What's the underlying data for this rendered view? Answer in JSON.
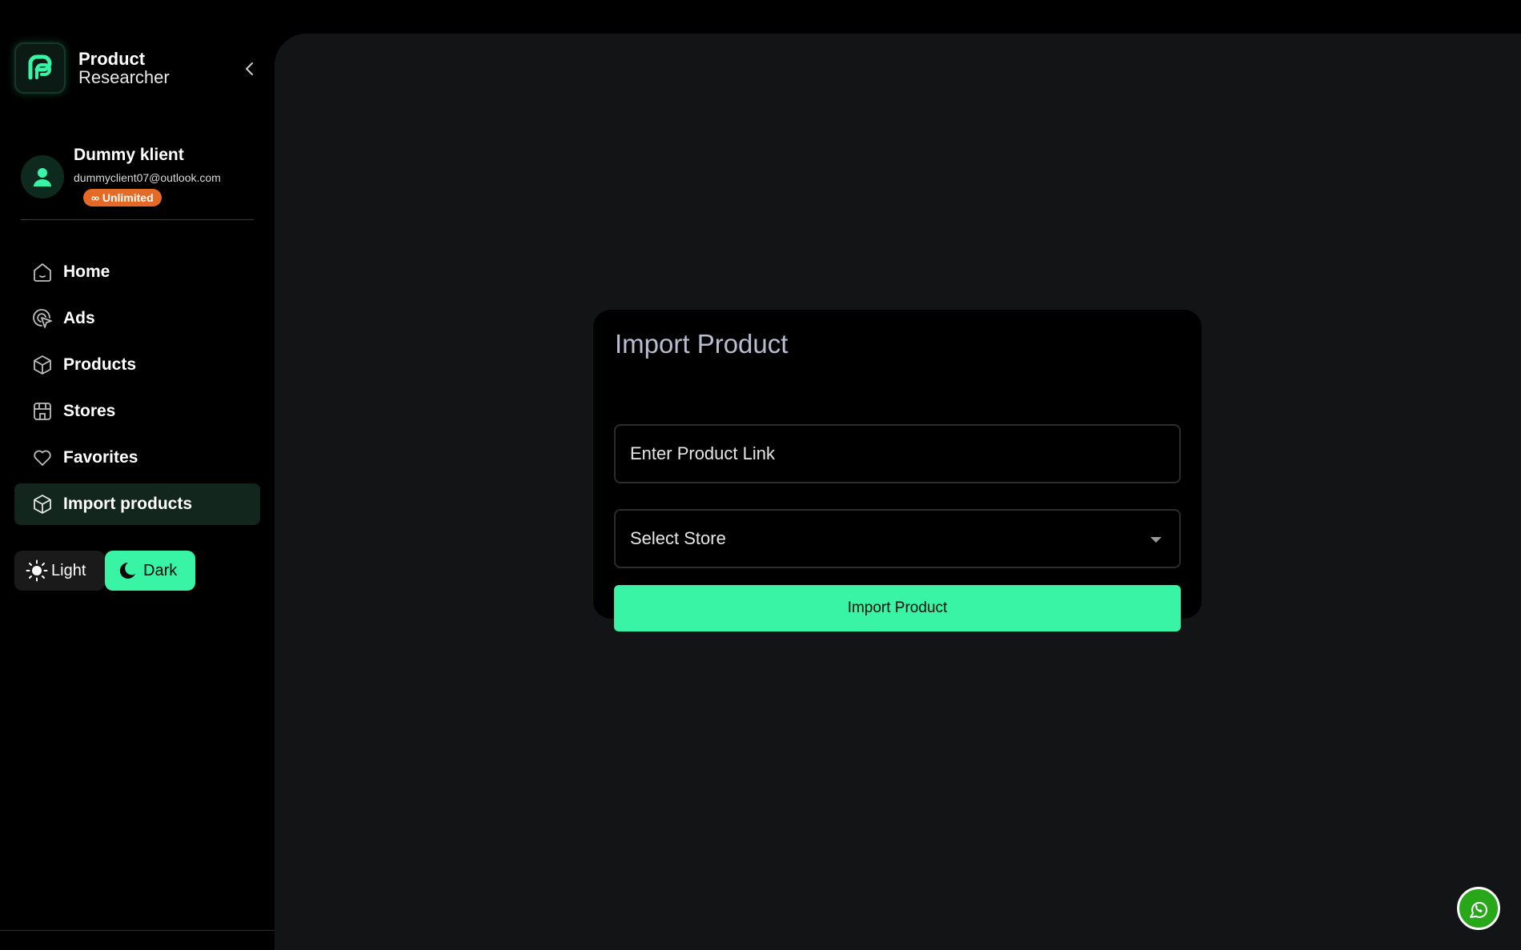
{
  "brand": {
    "line1": "Product",
    "line2": "Researcher",
    "logo_icon": "product-researcher-logo",
    "accent_color": "#3af4a5"
  },
  "user": {
    "name": "Dummy klient",
    "email": "dummyclient07@outlook.com",
    "plan": "∞ Unlimited",
    "plan_color": "#e56a26"
  },
  "nav": {
    "items": [
      {
        "label": "Home",
        "icon": "home-icon"
      },
      {
        "label": "Ads",
        "icon": "ads-cursor-icon"
      },
      {
        "label": "Products",
        "icon": "box-icon"
      },
      {
        "label": "Stores",
        "icon": "store-icon"
      },
      {
        "label": "Favorites",
        "icon": "heart-icon"
      },
      {
        "label": "Import products",
        "icon": "box-icon",
        "active": true
      }
    ]
  },
  "theme": {
    "light_label": "Light",
    "dark_label": "Dark",
    "selected": "Dark"
  },
  "import_card": {
    "title": "Import Product",
    "link_placeholder": "Enter Product Link",
    "store_placeholder": "Select Store",
    "button_label": "Import Product"
  }
}
